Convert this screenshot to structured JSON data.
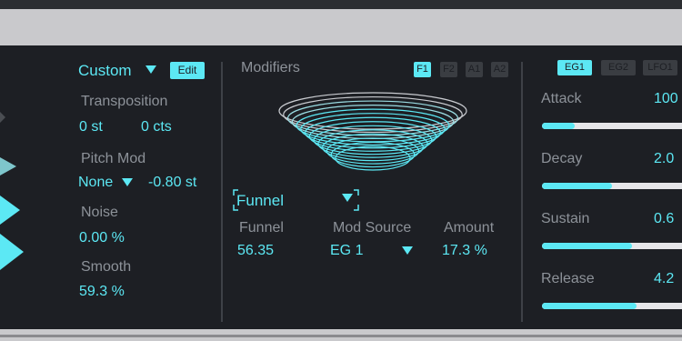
{
  "colors": {
    "accent": "#5ce8f4",
    "label": "#8d9299",
    "panel": "#1d1f24",
    "frame": "#c9c9cc"
  },
  "oscillator": {
    "preset": "Custom",
    "edit_label": "Edit",
    "transposition_label": "Transposition",
    "semitones": "0 st",
    "cents": "0 cts",
    "pitch_mod_label": "Pitch Mod",
    "pitch_mod_source": "None",
    "pitch_mod_amount": "-0.80 st",
    "noise_label": "Noise",
    "noise_value": "0.00 %",
    "smooth_label": "Smooth",
    "smooth_value": "59.3 %"
  },
  "modifiers": {
    "title": "Modifiers",
    "tabs": [
      {
        "label": "F1",
        "active": true
      },
      {
        "label": "F2",
        "active": false
      },
      {
        "label": "A1",
        "active": false
      },
      {
        "label": "A2",
        "active": false
      }
    ],
    "shape": "Funnel",
    "funnel_label": "Funnel",
    "funnel_value": "56.35",
    "mod_source_label": "Mod Source",
    "mod_source_value": "EG 1",
    "amount_label": "Amount",
    "amount_value": "17.3 %"
  },
  "envelope": {
    "tabs": [
      {
        "label": "EG1",
        "active": true
      },
      {
        "label": "EG2",
        "active": false
      },
      {
        "label": "LFO1",
        "active": false
      }
    ],
    "params": [
      {
        "label": "Attack",
        "value": "100",
        "level": 0.21
      },
      {
        "label": "Decay",
        "value": "2.0",
        "level": 0.45
      },
      {
        "label": "Sustain",
        "value": "0.6",
        "level": 0.58
      },
      {
        "label": "Release",
        "value": "4.2",
        "level": 0.61
      }
    ]
  }
}
